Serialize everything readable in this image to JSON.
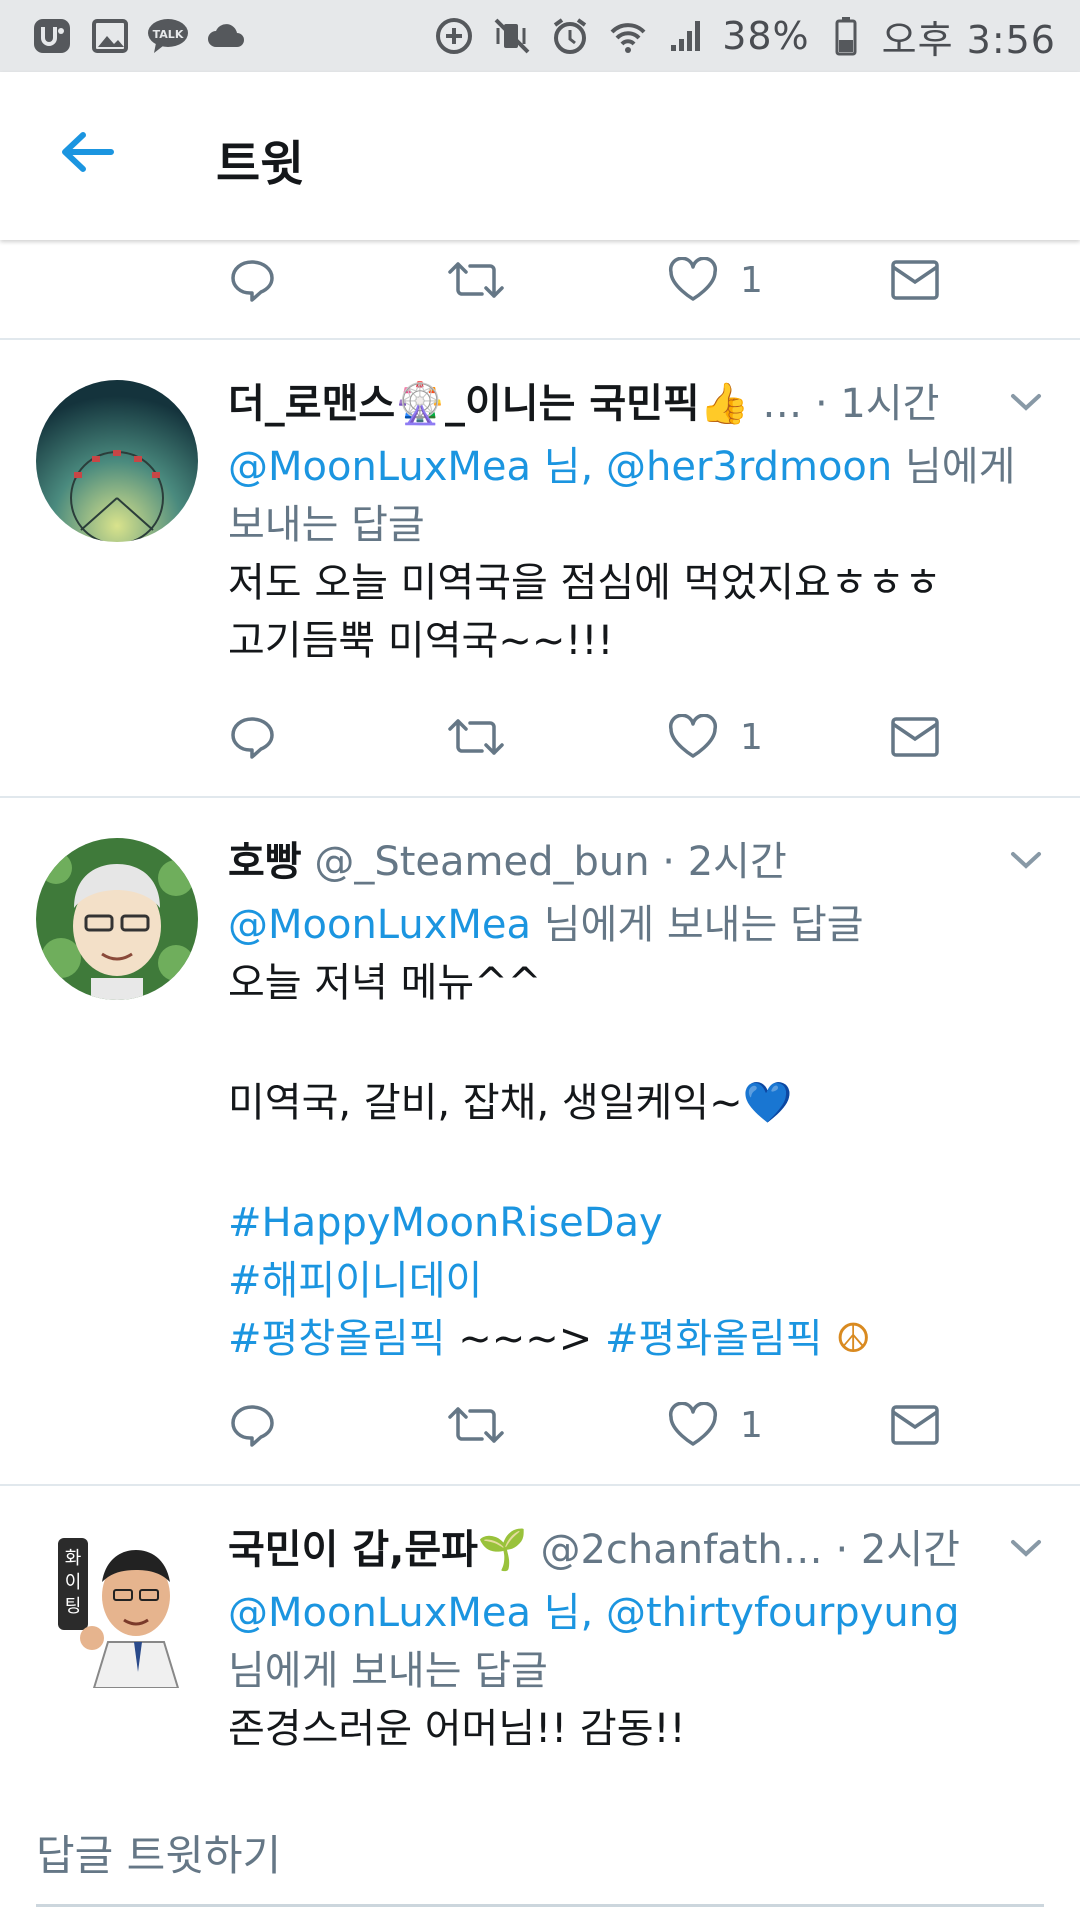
{
  "status_bar": {
    "battery": "38%",
    "time": "오후 3:56"
  },
  "header": {
    "title": "트윗"
  },
  "top_actions": {
    "like_count": "1"
  },
  "tweets": [
    {
      "name": "더_로맨스🎡_이니는 국민픽👍",
      "ellipsis": "…",
      "time": "· 1시간",
      "reply_to_mention1": "@MoonLuxMea 님, ",
      "reply_to_mention2": "@her3rdmoon",
      "reply_to_suffix": " 님에게",
      "reply_to_line2": "보내는 답글",
      "body_line1": "저도 오늘 미역국을 점심에 먹었지요ㅎㅎㅎ",
      "body_line2": "고기듬뿍 미역국~~!!!",
      "like_count": "1"
    },
    {
      "name": "호빵",
      "handle": " @_Steamed_bun",
      "time": " · 2시간",
      "reply_to_mention": "@MoonLuxMea",
      "reply_to_suffix": " 님에게 보내는 답글",
      "body_line1": "오늘 저녁 메뉴^^",
      "body_line2": "미역국, 갈비, 잡채, 생일케익~💙",
      "tag1": "#HappyMoonRiseDay",
      "tag2": "#해피이니데이",
      "tag3": "#평창올림픽",
      "tag_mid": " ~~~> ",
      "tag4": "#평화올림픽",
      "tag_end": " ☮",
      "like_count": "1"
    },
    {
      "name": "국민이 갑,문파🌱",
      "handle": " @2chanfath…",
      "time": " · 2시간",
      "reply_to_mention1": "@MoonLuxMea 님, ",
      "reply_to_mention2": "@thirtyfourpyung",
      "reply_to_line2": "님에게 보내는 답글",
      "body_line1": "존경스러운 어머님!! 감동!!"
    }
  ],
  "composer": {
    "placeholder": "답글 트윗하기"
  },
  "colors": {
    "accent": "#1b95e0",
    "secondary_text": "#657786",
    "divider": "#e1e8ed",
    "status_bg": "#e6e8ea"
  }
}
